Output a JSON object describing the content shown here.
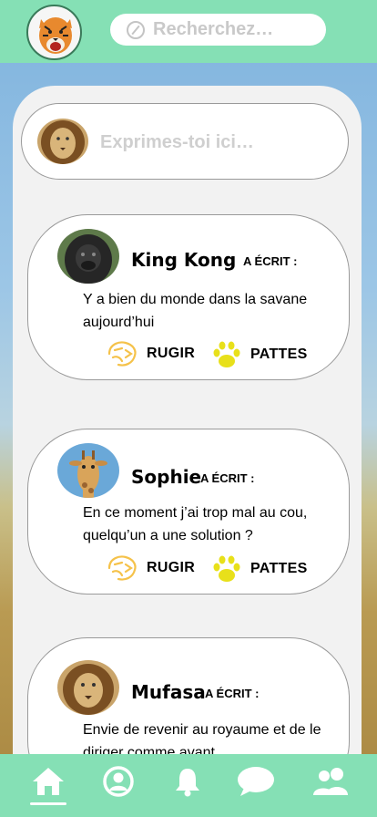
{
  "header": {
    "logo_icon": "tiger-avatar",
    "search": {
      "placeholder": "Recherchez…",
      "icon": "compass-icon"
    }
  },
  "composer": {
    "avatar_icon": "lion-avatar",
    "placeholder": "Exprimes-toi ici…"
  },
  "posts": [
    {
      "author": "King Kong",
      "wrote_label": "A ÉCRIT :",
      "text": "Y a bien du monde dans la savane aujourd’hui",
      "avatar_icon": "gorilla-avatar",
      "actions": [
        {
          "label": "RUGIR",
          "icon": "lion-roar-icon"
        },
        {
          "label": "PATTES",
          "icon": "paw-icon"
        }
      ]
    },
    {
      "author": "Sophie",
      "wrote_label": "A ÉCRIT :",
      "text": "En ce moment j’ai trop mal au cou, quelqu’un a une solution ?",
      "avatar_icon": "giraffe-avatar",
      "actions": [
        {
          "label": "RUGIR",
          "icon": "lion-roar-icon"
        },
        {
          "label": "PATTES",
          "icon": "paw-icon"
        }
      ]
    },
    {
      "author": "Mufasa",
      "wrote_label": "A ÉCRIT :",
      "text": "Envie de revenir au royaume et de le diriger comme avant",
      "avatar_icon": "lion-avatar",
      "actions": []
    }
  ],
  "navbar": {
    "items": [
      {
        "icon": "home-icon",
        "active": true
      },
      {
        "icon": "profile-icon",
        "active": false
      },
      {
        "icon": "bell-icon",
        "active": false
      },
      {
        "icon": "chat-icon",
        "active": false
      },
      {
        "icon": "friends-icon",
        "active": false
      }
    ]
  },
  "colors": {
    "header_bg": "#85e0b5",
    "roar_icon": "#f5c24a",
    "paw_icon": "#e8e01a",
    "panel_bg": "#f2f2f2"
  }
}
